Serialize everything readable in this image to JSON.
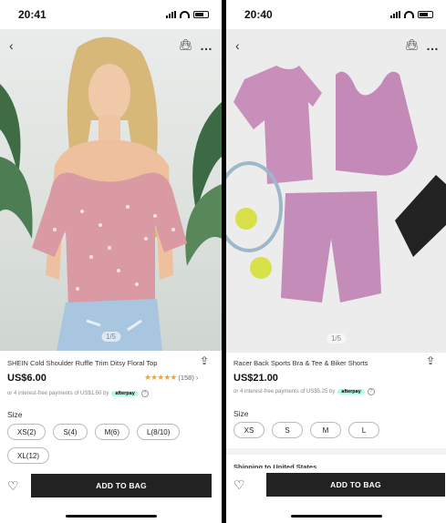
{
  "left": {
    "time": "20:41",
    "pager": "1/5",
    "title": "SHEIN Cold Shoulder Ruffle Trim Ditsy Floral Top",
    "price": "US$6.00",
    "rating_count": "(158)",
    "afterpay_text": "or 4 interest-free payments of US$1.50 by",
    "afterpay_badge": "afterpay",
    "size_label": "Size",
    "sizes": [
      "XS(2)",
      "S(4)",
      "M(6)",
      "L(8/10)",
      "XL(12)"
    ],
    "add_label": "ADD TO BAG"
  },
  "right": {
    "time": "20:40",
    "pager": "1/5",
    "title": "Racer Back Sports Bra & Tee & Biker Shorts",
    "price": "US$21.00",
    "afterpay_text": "or 4 interest-free payments of US$5.25 by",
    "afterpay_badge": "afterpay",
    "size_label": "Size",
    "sizes": [
      "XS",
      "S",
      "M",
      "L"
    ],
    "shipping": "Shipping to United States",
    "add_label": "ADD TO BAG"
  },
  "colors": {
    "add_button": "#222222",
    "stars": "#f5a623",
    "afterpay": "#b2fce4"
  },
  "icons": [
    "back-chevron-icon",
    "bag-icon",
    "more-icon",
    "share-icon",
    "heart-icon",
    "star-icon",
    "question-icon"
  ]
}
